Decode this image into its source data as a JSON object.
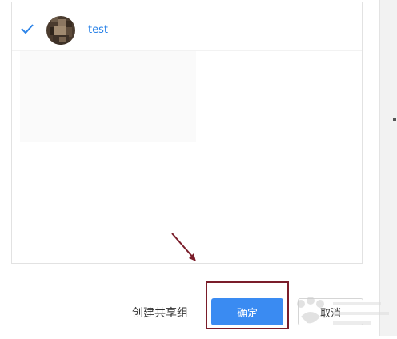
{
  "members": [
    {
      "name": "test",
      "selected": true,
      "avatar_icon": "user-avatar-photo"
    }
  ],
  "footer": {
    "create_group_label": "创建共享组",
    "confirm_label": "确定",
    "cancel_label": "取消"
  },
  "colors": {
    "accent": "#3a8bf2",
    "link": "#2d84e8",
    "annotation": "#7a1d2a"
  }
}
